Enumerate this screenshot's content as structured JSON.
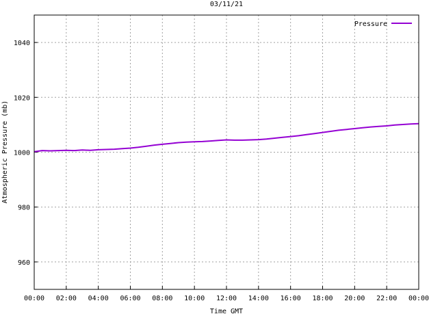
{
  "chart_data": {
    "type": "line",
    "title": "03/11/21",
    "xlabel": "Time GMT",
    "ylabel": "Atmospheric Pressure (mb)",
    "x_ticks": [
      "00:00",
      "02:00",
      "04:00",
      "06:00",
      "08:00",
      "10:00",
      "12:00",
      "14:00",
      "16:00",
      "18:00",
      "20:00",
      "22:00",
      "00:00"
    ],
    "xlim_hours": [
      0,
      24
    ],
    "ylim": [
      950,
      1050
    ],
    "y_ticks": [
      960,
      980,
      1000,
      1020,
      1040
    ],
    "grid": true,
    "legend_position": "top-right",
    "series": [
      {
        "name": "Pressure",
        "color": "#9400d3",
        "x_hours": [
          0,
          0.5,
          1,
          1.5,
          2,
          2.5,
          3,
          3.5,
          4,
          4.5,
          5,
          5.5,
          6,
          6.5,
          7,
          7.5,
          8,
          8.5,
          9,
          9.5,
          10,
          10.5,
          11,
          11.5,
          12,
          12.5,
          13,
          13.5,
          14,
          14.5,
          15,
          15.5,
          16,
          16.5,
          17,
          17.5,
          18,
          18.5,
          19,
          19.5,
          20,
          20.5,
          21,
          21.5,
          22,
          22.5,
          23,
          23.5,
          24
        ],
        "values": [
          1000.2,
          1000.6,
          1000.5,
          1000.6,
          1000.7,
          1000.6,
          1000.8,
          1000.7,
          1000.9,
          1001.0,
          1001.1,
          1001.3,
          1001.5,
          1001.8,
          1002.2,
          1002.6,
          1002.9,
          1003.2,
          1003.5,
          1003.7,
          1003.8,
          1003.9,
          1004.1,
          1004.3,
          1004.5,
          1004.4,
          1004.4,
          1004.5,
          1004.6,
          1004.8,
          1005.1,
          1005.4,
          1005.7,
          1006.0,
          1006.4,
          1006.8,
          1007.2,
          1007.6,
          1008.0,
          1008.3,
          1008.6,
          1008.9,
          1009.2,
          1009.4,
          1009.6,
          1009.9,
          1010.1,
          1010.3,
          1010.4
        ]
      }
    ]
  }
}
